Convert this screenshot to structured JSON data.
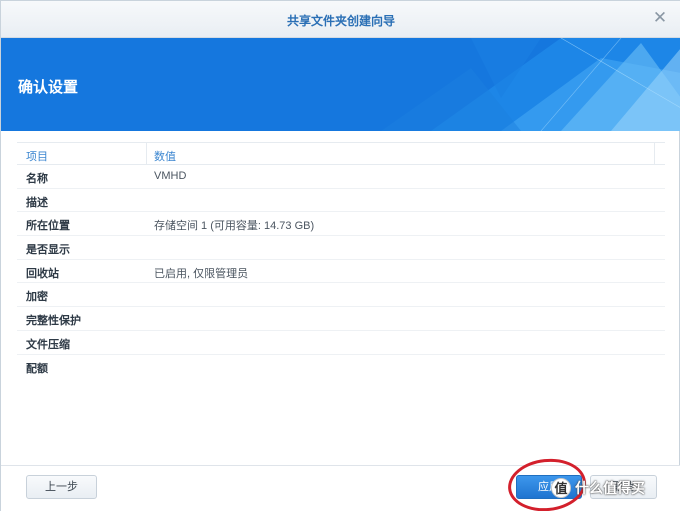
{
  "window": {
    "title": "共享文件夹创建向导",
    "close_glyph": "✕"
  },
  "banner": {
    "heading": "确认设置",
    "color": "#1577de"
  },
  "table": {
    "headers": [
      "项目",
      "数值"
    ],
    "rows": [
      {
        "key": "名称",
        "value": "VMHD"
      },
      {
        "key": "描述",
        "value": ""
      },
      {
        "key": "所在位置",
        "value": "存储空间 1 (可用容量:  14.73 GB)"
      },
      {
        "key": "是否显示",
        "value": ""
      },
      {
        "key": "回收站",
        "value": "已启用, 仅限管理员"
      },
      {
        "key": "加密",
        "value": ""
      },
      {
        "key": "完整性保护",
        "value": ""
      },
      {
        "key": "文件压缩",
        "value": ""
      },
      {
        "key": "配额",
        "value": ""
      }
    ]
  },
  "footer": {
    "prev_label": "上一步",
    "apply_label": "应用",
    "cancel_label": "取消"
  },
  "watermark": {
    "badge": "值",
    "text": "什么值得买"
  }
}
